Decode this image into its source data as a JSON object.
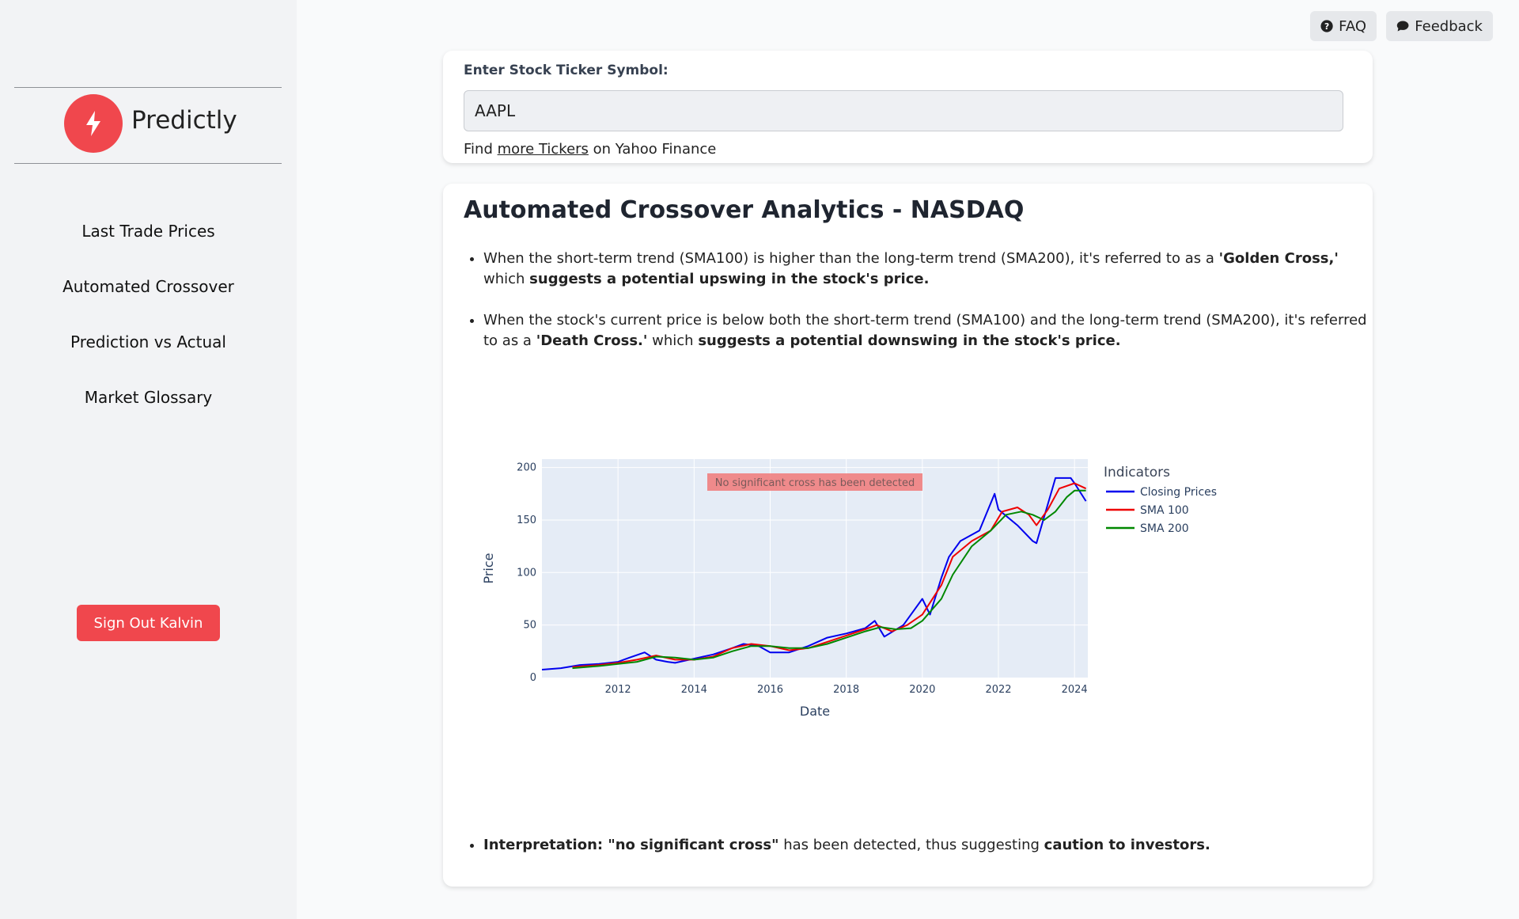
{
  "sidebar": {
    "brand": "Predictly",
    "nav": [
      "Last Trade Prices",
      "Automated Crossover",
      "Prediction vs Actual",
      "Market Glossary"
    ],
    "signout_label": "Sign Out Kalvin",
    "accent": "#f0474d"
  },
  "topbar": {
    "faq_label": "FAQ",
    "feedback_label": "Feedback",
    "faq_icon": "question-circle-icon",
    "feedback_icon": "chat-bubble-icon"
  },
  "ticker": {
    "label": "Enter Stock Ticker Symbol:",
    "value": "AAPL",
    "help_prefix": "Find ",
    "help_link": "more Tickers",
    "help_suffix": " on Yahoo Finance"
  },
  "analytics": {
    "title": "Automated Crossover Analytics - NASDAQ",
    "b1_text": "When the short-term trend (SMA100) is higher than the long-term trend (SMA200), it's referred to as a ",
    "b1_bold1": "'Golden Cross,'",
    "b1_text2": " which ",
    "b1_bold2": "suggests a potential upswing in the stock's price.",
    "b2_text": "When the stock's current price is below both the short-term trend (SMA100) and the long-term trend (SMA200), it's referred to as a ",
    "b2_bold1": "'Death Cross.'",
    "b2_text2": " which ",
    "b2_bold2": "suggests a potential downswing in the stock's price.",
    "interp_bold1": "Interpretation: \"no significant cross\"",
    "interp_text": " has been detected, thus suggesting ",
    "interp_bold2": "caution to investors."
  },
  "chart_data": {
    "type": "line",
    "xlabel": "Date",
    "ylabel": "Price",
    "xlim": [
      2010.0,
      2024.35
    ],
    "ylim": [
      0,
      208
    ],
    "x_ticks": [
      2012,
      2014,
      2016,
      2018,
      2020,
      2022,
      2024
    ],
    "y_ticks": [
      0,
      50,
      100,
      150,
      200
    ],
    "annotation": "No significant cross has been detected",
    "legend_title": "Indicators",
    "grid": true,
    "legend_placement": "right",
    "series": [
      {
        "name": "Closing Prices",
        "color": "#0000ee",
        "x": [
          2010.0,
          2010.5,
          2011.0,
          2011.5,
          2012.0,
          2012.3,
          2012.7,
          2013.0,
          2013.3,
          2013.5,
          2014.0,
          2014.5,
          2015.0,
          2015.3,
          2015.7,
          2016.0,
          2016.5,
          2017.0,
          2017.5,
          2018.0,
          2018.5,
          2018.75,
          2019.0,
          2019.5,
          2020.0,
          2020.2,
          2020.5,
          2020.7,
          2021.0,
          2021.5,
          2021.9,
          2022.0,
          2022.5,
          2022.9,
          2023.0,
          2023.5,
          2023.9,
          2024.0,
          2024.3
        ],
        "y": [
          7.5,
          9,
          12,
          13,
          15,
          19,
          24,
          17,
          15,
          14,
          18,
          22,
          28,
          32,
          30,
          24,
          24,
          30,
          38,
          42,
          47,
          54,
          39,
          50,
          75,
          60,
          95,
          115,
          130,
          140,
          175,
          160,
          145,
          130,
          128,
          190,
          190,
          185,
          168
        ]
      },
      {
        "name": "SMA 100",
        "color": "#ee0000",
        "x": [
          2010.8,
          2011.5,
          2012.0,
          2012.5,
          2013.0,
          2013.5,
          2014.0,
          2014.5,
          2015.0,
          2015.5,
          2016.0,
          2016.5,
          2017.0,
          2017.5,
          2018.0,
          2018.5,
          2018.8,
          2019.2,
          2019.6,
          2020.0,
          2020.5,
          2020.8,
          2021.3,
          2021.8,
          2022.1,
          2022.5,
          2022.8,
          2023.0,
          2023.3,
          2023.6,
          2024.0,
          2024.3
        ],
        "y": [
          10,
          12,
          14,
          17,
          21,
          17,
          17,
          20,
          28,
          32,
          30,
          26,
          28,
          34,
          40,
          46,
          50,
          44,
          50,
          60,
          88,
          115,
          130,
          140,
          158,
          162,
          155,
          145,
          160,
          180,
          185,
          180
        ]
      },
      {
        "name": "SMA 200",
        "color": "#008800",
        "x": [
          2010.8,
          2011.5,
          2012.0,
          2012.5,
          2013.0,
          2013.5,
          2014.0,
          2014.5,
          2015.0,
          2015.5,
          2016.0,
          2016.5,
          2017.0,
          2017.5,
          2018.0,
          2018.5,
          2018.9,
          2019.3,
          2019.7,
          2020.0,
          2020.5,
          2020.8,
          2021.3,
          2021.8,
          2022.2,
          2022.6,
          2022.9,
          2023.2,
          2023.5,
          2023.8,
          2024.0,
          2024.3
        ],
        "y": [
          9,
          11,
          13,
          15,
          20,
          19,
          17,
          19,
          25,
          30,
          30,
          28,
          28,
          32,
          38,
          44,
          48,
          46,
          47,
          54,
          75,
          98,
          125,
          140,
          155,
          158,
          155,
          150,
          158,
          172,
          178,
          178
        ]
      }
    ]
  }
}
